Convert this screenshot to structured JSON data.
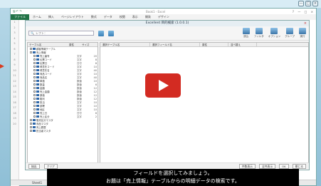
{
  "window": {
    "controls": [
      "—",
      "□",
      "×"
    ]
  },
  "excel": {
    "title": "Book1 - Excel",
    "quick_access": "🖫 ↶ ↷",
    "window_buttons": "? — □ ×",
    "tabs": [
      "ファイル",
      "ホーム",
      "挿入",
      "ページレイアウト",
      "数式",
      "データ",
      "校閲",
      "表示",
      "開発",
      "デザイン"
    ],
    "sheet_tab": "Sheet1"
  },
  "dialog": {
    "title": "Excellent 目的検索 (1.0.0.1)",
    "search_placeholder": "レフト：",
    "tree_headers": [
      "テーブル名",
      "属性",
      "サイズ"
    ],
    "field_headers": [
      "選択テーブル名",
      "選択フィールド名",
      "属性",
      "並べ替え"
    ],
    "tree_rows": [
      {
        "name": "顧客情報テーブル",
        "type": "",
        "size": ""
      },
      {
        "name": "売上情報",
        "type": "",
        "size": ""
      },
      {
        "name": "売上番号",
        "type": "文字",
        "size": "20"
      },
      {
        "name": "伝票コード",
        "type": "文字",
        "size": "8"
      },
      {
        "name": "伝票日",
        "type": "日付",
        "size": "8"
      },
      {
        "name": "得意先コード",
        "type": "文字",
        "size": "10"
      },
      {
        "name": "得意先名",
        "type": "文字",
        "size": "40"
      },
      {
        "name": "商品コード",
        "type": "文字",
        "size": "10"
      },
      {
        "name": "商品名",
        "type": "文字",
        "size": "40"
      },
      {
        "name": "単価",
        "type": "数値",
        "size": "10"
      },
      {
        "name": "数量",
        "type": "数値",
        "size": "6"
      },
      {
        "name": "金額",
        "type": "数値",
        "size": "12"
      },
      {
        "name": "売上金額",
        "type": "数値",
        "size": "12"
      },
      {
        "name": "原価",
        "type": "数値",
        "size": "12"
      },
      {
        "name": "粗利",
        "type": "数値",
        "size": "12"
      },
      {
        "name": "担当",
        "type": "文字",
        "size": "10"
      },
      {
        "name": "部署",
        "type": "文字",
        "size": "10"
      },
      {
        "name": "地区",
        "type": "文字",
        "size": "10"
      },
      {
        "name": "売上日",
        "type": "日付",
        "size": "8"
      },
      {
        "name": "売上区分",
        "type": "文字",
        "size": "2"
      },
      {
        "name": "販売区分マスタ",
        "type": "",
        "size": ""
      },
      {
        "name": "商品マスタ",
        "type": "",
        "size": ""
      },
      {
        "name": "売上履歴",
        "type": "",
        "size": ""
      },
      {
        "name": "担当者マスタ",
        "type": "",
        "size": ""
      }
    ],
    "buttons_right": [
      {
        "label": "読込"
      },
      {
        "label": "フィルタ"
      },
      {
        "label": "オプション"
      },
      {
        "label": "グループ"
      },
      {
        "label": "実行"
      }
    ],
    "bottom_left": [
      "抽出",
      "クリア"
    ],
    "bottom_right": [
      "件数表示",
      "全件表示",
      "OK",
      "閉じる"
    ]
  },
  "caption": {
    "line1": "フィールドを選択してみましょう。",
    "line2": "お題は「売上情報」テーブルからの明細データの検索です。"
  },
  "colors": {
    "play_button": "#d32b22",
    "excel_green": "#217346"
  }
}
